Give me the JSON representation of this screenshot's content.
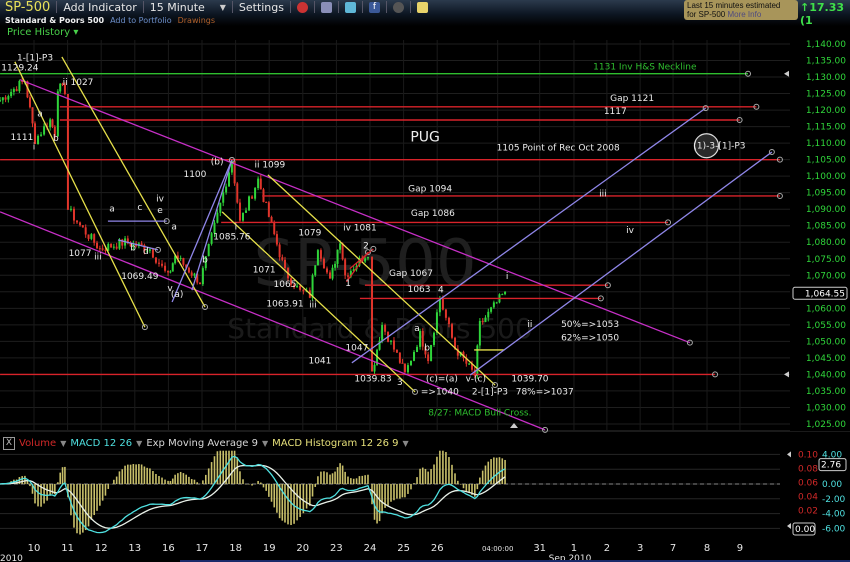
{
  "toolbar": {
    "symbol": "SP-500",
    "add_indicator": "Add Indicator",
    "interval": "15 Minute",
    "settings": "Settings",
    "name": "Standard & Poors 500",
    "add_portfolio": "Add to Portfolio",
    "drawings": "Drawings",
    "price_history": "Price History ▾",
    "estimate_line1": "Last 15 minutes estimated",
    "estimate_line2": "for SP-500",
    "more_info": "More Info",
    "change": "17.33 (1"
  },
  "indicators": {
    "volume": "Volume",
    "macd": "MACD 12 26",
    "ema": "Exp Moving Average 9",
    "hist": "MACD Histogram 12 26 9",
    "close_label": "X"
  },
  "colors": {
    "price_up": "#2fd43a",
    "price_down": "#e0352b",
    "axis": "#2fd43a",
    "neckline": "#2fbf2f",
    "level": "#d8232a",
    "channel": "#c62fc6",
    "yellow": "#e6e04a",
    "lavender": "#8f86e8",
    "macd": "#4fe0e0",
    "signal": "#e8f0e8",
    "hist": "#c9c06a"
  },
  "chart_data": {
    "type": "candlestick",
    "title": "SP-500 15 Minute",
    "watermark": "SP-500",
    "watermark2": "Standard & Poors 500",
    "ylim": [
      1025,
      1140
    ],
    "yticks": [
      "1,140.00",
      "1,135.00",
      "1,130.00",
      "1,125.00",
      "1,120.00",
      "1,115.00",
      "1,110.00",
      "1,105.00",
      "1,100.00",
      "1,095.00",
      "1,090.00",
      "1,085.00",
      "1,080.00",
      "1,075.00",
      "1,070.00",
      "1,060.00",
      "1,055.00",
      "1,050.00",
      "1,045.00",
      "1,040.00",
      "1,035.00",
      "1,030.00",
      "1,025.00"
    ],
    "ytick_values": [
      1140,
      1135,
      1130,
      1125,
      1120,
      1115,
      1110,
      1105,
      1100,
      1095,
      1090,
      1085,
      1080,
      1075,
      1070,
      1060,
      1055,
      1050,
      1045,
      1040,
      1035,
      1030,
      1025
    ],
    "last_price": "1,064.55",
    "last_value": 1064.55,
    "x_unit": "trading days from Aug 10",
    "xlim": [
      -1.01,
      23.3
    ],
    "xticks": [
      {
        "d": 0,
        "label": "10"
      },
      {
        "d": 1,
        "label": "11"
      },
      {
        "d": 2,
        "label": "12"
      },
      {
        "d": 3,
        "label": "13"
      },
      {
        "d": 4,
        "label": "16"
      },
      {
        "d": 5,
        "label": "17"
      },
      {
        "d": 6,
        "label": "18"
      },
      {
        "d": 7,
        "label": "19"
      },
      {
        "d": 8,
        "label": "20"
      },
      {
        "d": 9,
        "label": "23"
      },
      {
        "d": 10,
        "label": "24"
      },
      {
        "d": 11,
        "label": "25"
      },
      {
        "d": 12,
        "label": "26"
      },
      {
        "d": 13.8,
        "label": "04:00:00"
      },
      {
        "d": 15.05,
        "label": "31"
      },
      {
        "d": 16.07,
        "label": "1"
      },
      {
        "d": 17.05,
        "label": "2"
      },
      {
        "d": 18.04,
        "label": "3"
      },
      {
        "d": 19.02,
        "label": "7"
      },
      {
        "d": 20.03,
        "label": "8"
      },
      {
        "d": 21.01,
        "label": "9"
      }
    ],
    "xaxis_left": "2010",
    "xaxis_month": "Sep 2010",
    "price_path": [
      [
        -1.01,
        1123
      ],
      [
        -0.27,
        1129
      ],
      [
        0.03,
        1111
      ],
      [
        0.48,
        1117
      ],
      [
        0.62,
        1113
      ],
      [
        0.71,
        1127
      ],
      [
        0.92,
        1126
      ],
      [
        1.01,
        1090
      ],
      [
        1.37,
        1085
      ],
      [
        1.96,
        1078
      ],
      [
        2.71,
        1080
      ],
      [
        3.45,
        1078
      ],
      [
        3.99,
        1069.5
      ],
      [
        4.2,
        1076
      ],
      [
        4.94,
        1068
      ],
      [
        5.89,
        1105
      ],
      [
        6.13,
        1086
      ],
      [
        6.67,
        1099
      ],
      [
        7.47,
        1071
      ],
      [
        7.92,
        1065
      ],
      [
        8.21,
        1064
      ],
      [
        8.45,
        1079
      ],
      [
        8.81,
        1068
      ],
      [
        9.11,
        1081
      ],
      [
        9.26,
        1070
      ],
      [
        9.94,
        1077
      ],
      [
        10.06,
        1040.5
      ],
      [
        10.36,
        1055
      ],
      [
        10.89,
        1044
      ],
      [
        11.04,
        1040
      ],
      [
        11.49,
        1052
      ],
      [
        11.73,
        1045
      ],
      [
        12.08,
        1063
      ],
      [
        12.53,
        1048
      ],
      [
        13.12,
        1039.7
      ],
      [
        13.27,
        1055
      ],
      [
        14.02,
        1065
      ]
    ],
    "hlines": [
      {
        "price": 1131,
        "from": -1.01,
        "to": 21.25,
        "color": "neckline"
      },
      {
        "price": 1121,
        "from": 0.77,
        "to": 21.5,
        "color": "level"
      },
      {
        "price": 1117,
        "from": 0.77,
        "to": 21.0,
        "color": "level"
      },
      {
        "price": 1105,
        "from": -1.01,
        "to": 22.2,
        "color": "level"
      },
      {
        "price": 1094,
        "from": 6.79,
        "to": 22.2,
        "color": "level"
      },
      {
        "price": 1086,
        "from": 5.57,
        "to": 18.87,
        "color": "level"
      },
      {
        "price": 1067,
        "from": 9.85,
        "to": 17.08,
        "color": "level"
      },
      {
        "price": 1063,
        "from": 9.7,
        "to": 16.87,
        "color": "level"
      },
      {
        "price": 1040,
        "from": -1.01,
        "to": 20.27,
        "color": "level"
      },
      {
        "price": 1047.4,
        "from": 13.1,
        "to": 14.0,
        "color": "yellow"
      }
    ],
    "trendlines": [
      {
        "p1": [
          -0.42,
          1129.2
        ],
        "p2": [
          19.52,
          1049.6
        ],
        "color": "channel"
      },
      {
        "p1": [
          -1.01,
          1089.2
        ],
        "p2": [
          15.21,
          1023.2
        ],
        "color": "channel"
      },
      {
        "p1": [
          0.83,
          1136.1
        ],
        "p2": [
          5.09,
          1060.4
        ],
        "color": "yellow"
      },
      {
        "p1": [
          -0.57,
          1134.6
        ],
        "p2": [
          3.3,
          1054.3
        ],
        "color": "yellow"
      },
      {
        "p1": [
          5.6,
          1089.2
        ],
        "p2": [
          11.34,
          1034.7
        ],
        "color": "yellow"
      },
      {
        "p1": [
          6.96,
          1100.4
        ],
        "p2": [
          13.72,
          1036.8
        ],
        "color": "yellow"
      },
      {
        "p1": [
          9.46,
          1043.5
        ],
        "p2": [
          19.99,
          1120.6
        ],
        "color": "lavender"
      },
      {
        "p1": [
          12.98,
          1039.8
        ],
        "p2": [
          21.96,
          1107.3
        ],
        "color": "lavender"
      },
      {
        "p1": [
          4.11,
          1061.9
        ],
        "p2": [
          5.89,
          1104.9
        ],
        "color": "lavender"
      },
      {
        "p1": [
          4.7,
          1065.5
        ],
        "p2": [
          5.89,
          1104.9
        ],
        "color": "lavender"
      },
      {
        "p1": [
          2.2,
          1086.4
        ],
        "p2": [
          3.95,
          1086.4
        ],
        "color": "lavender"
      },
      {
        "p1": [
          2.5,
          1080.7
        ],
        "p2": [
          3.69,
          1077.7
        ],
        "color": "lavender"
      },
      {
        "p1": [
          9.3,
          1068
        ],
        "p2": [
          9.94,
          1077
        ],
        "color": "level"
      },
      {
        "p1": [
          9.4,
          1072
        ],
        "p2": [
          10.1,
          1078
        ],
        "color": "level"
      }
    ],
    "annotations": [
      {
        "d": 0.03,
        "p": 1135,
        "text": "1-[1]-P3"
      },
      {
        "d": -0.42,
        "p": 1132,
        "text": "1129.24"
      },
      {
        "d": 1.31,
        "p": 1127.6,
        "text": "ii 1027"
      },
      {
        "d": -0.36,
        "p": 1111,
        "text": "1111"
      },
      {
        "d": 0.0,
        "p": 1108,
        "text": "i"
      },
      {
        "d": 0.18,
        "p": 1118,
        "text": "a"
      },
      {
        "d": 0.65,
        "p": 1110.6,
        "text": "b"
      },
      {
        "d": 11.64,
        "p": 1110.5,
        "text": "PUG",
        "size": 14
      },
      {
        "d": 18.18,
        "p": 1132.3,
        "text": "1131 Inv H&S Neckline",
        "color": "neckline"
      },
      {
        "d": 17.8,
        "p": 1122.8,
        "text": "Gap 1121"
      },
      {
        "d": 17.3,
        "p": 1118.8,
        "text": "1117"
      },
      {
        "d": 15.6,
        "p": 1107.8,
        "text": "1105 Point of Rec Oct 2008"
      },
      {
        "d": 20.4,
        "p": 1108.3,
        "text": "(1)-3-[1]-P3",
        "circle": true
      },
      {
        "d": 5.45,
        "p": 1103.5,
        "text": "(b)"
      },
      {
        "d": 7.02,
        "p": 1102.6,
        "text": "ii 1099"
      },
      {
        "d": 4.79,
        "p": 1099.8,
        "text": "1100"
      },
      {
        "d": 11.79,
        "p": 1095.3,
        "text": "Gap 1094"
      },
      {
        "d": 16.93,
        "p": 1093.9,
        "text": "iii"
      },
      {
        "d": 2.32,
        "p": 1089.3,
        "text": "a"
      },
      {
        "d": 3.15,
        "p": 1089.8,
        "text": "c"
      },
      {
        "d": 3.75,
        "p": 1092.4,
        "text": "iv"
      },
      {
        "d": 3.75,
        "p": 1088.8,
        "text": "e"
      },
      {
        "d": 11.87,
        "p": 1088,
        "text": "Gap 1086"
      },
      {
        "d": 17.74,
        "p": 1082.8,
        "text": "iv"
      },
      {
        "d": 6.01,
        "p": 1083.8,
        "text": "i"
      },
      {
        "d": 5.89,
        "p": 1080.8,
        "text": "1085.76"
      },
      {
        "d": 8.21,
        "p": 1082,
        "text": "1079"
      },
      {
        "d": 9.7,
        "p": 1083.5,
        "text": "iv  1081"
      },
      {
        "d": 9.88,
        "p": 1078.1,
        "text": "2"
      },
      {
        "d": 2.95,
        "p": 1077.5,
        "text": "b"
      },
      {
        "d": 3.33,
        "p": 1076.5,
        "text": "d"
      },
      {
        "d": 4.17,
        "p": 1083.8,
        "text": "a"
      },
      {
        "d": 1.37,
        "p": 1075.8,
        "text": "1077"
      },
      {
        "d": 1.9,
        "p": 1074.8,
        "text": "iii"
      },
      {
        "d": 5.09,
        "p": 1073.8,
        "text": "b"
      },
      {
        "d": 6.85,
        "p": 1070.8,
        "text": "1071"
      },
      {
        "d": 11.22,
        "p": 1069.8,
        "text": "Gap 1067"
      },
      {
        "d": 3.15,
        "p": 1068.8,
        "text": "1069.49"
      },
      {
        "d": 9.35,
        "p": 1066.8,
        "text": "1"
      },
      {
        "d": 7.47,
        "p": 1066.5,
        "text": "1065"
      },
      {
        "d": 11.46,
        "p": 1065,
        "text": "1063"
      },
      {
        "d": 12.11,
        "p": 1064.8,
        "text": "4"
      },
      {
        "d": 14.08,
        "p": 1068.8,
        "text": "i"
      },
      {
        "d": 4.05,
        "p": 1065.3,
        "text": "v"
      },
      {
        "d": 4.26,
        "p": 1063.5,
        "text": "(a)"
      },
      {
        "d": 7.47,
        "p": 1060.5,
        "text": "1063.91"
      },
      {
        "d": 8.3,
        "p": 1060.2,
        "text": "iii"
      },
      {
        "d": 14.76,
        "p": 1054.4,
        "text": "ii"
      },
      {
        "d": 16.55,
        "p": 1054.4,
        "text": "50%=>1053"
      },
      {
        "d": 11.4,
        "p": 1053.2,
        "text": "a"
      },
      {
        "d": 16.55,
        "p": 1050.2,
        "text": "62%=>1050"
      },
      {
        "d": 9.61,
        "p": 1047.2,
        "text": "1047"
      },
      {
        "d": 11.7,
        "p": 1047.2,
        "text": "b"
      },
      {
        "d": 8.51,
        "p": 1043.3,
        "text": "1041"
      },
      {
        "d": 10.09,
        "p": 1037.8,
        "text": "1039.83"
      },
      {
        "d": 10.89,
        "p": 1036.8,
        "text": "3"
      },
      {
        "d": 12.14,
        "p": 1037.8,
        "text": "(c)=(a)"
      },
      {
        "d": 13.15,
        "p": 1037.8,
        "text": "v-(c)"
      },
      {
        "d": 14.76,
        "p": 1037.8,
        "text": "1039.70"
      },
      {
        "d": 12.08,
        "p": 1033.9,
        "text": "=>1040"
      },
      {
        "d": 13.57,
        "p": 1033.9,
        "text": "2-[1]-P3"
      },
      {
        "d": 15.2,
        "p": 1033.9,
        "text": "78%=>1037"
      },
      {
        "d": 13.27,
        "p": 1027.5,
        "text": "8/27: MACD Bull Cross.",
        "color": "neckline"
      }
    ],
    "macd_panel": {
      "volume_ticks": [
        "0.10",
        "0.08",
        "0.06",
        "0.04",
        "0.02"
      ],
      "macd_ticks": [
        "4.00",
        "0.00",
        "-2.00",
        "-4.00",
        "-6.00"
      ],
      "macd_tick_values": [
        4,
        0,
        -2,
        -4,
        -6
      ],
      "macd_last": "2.76",
      "volume_last": "0.00",
      "ylim": [
        -7,
        4.5
      ]
    }
  }
}
